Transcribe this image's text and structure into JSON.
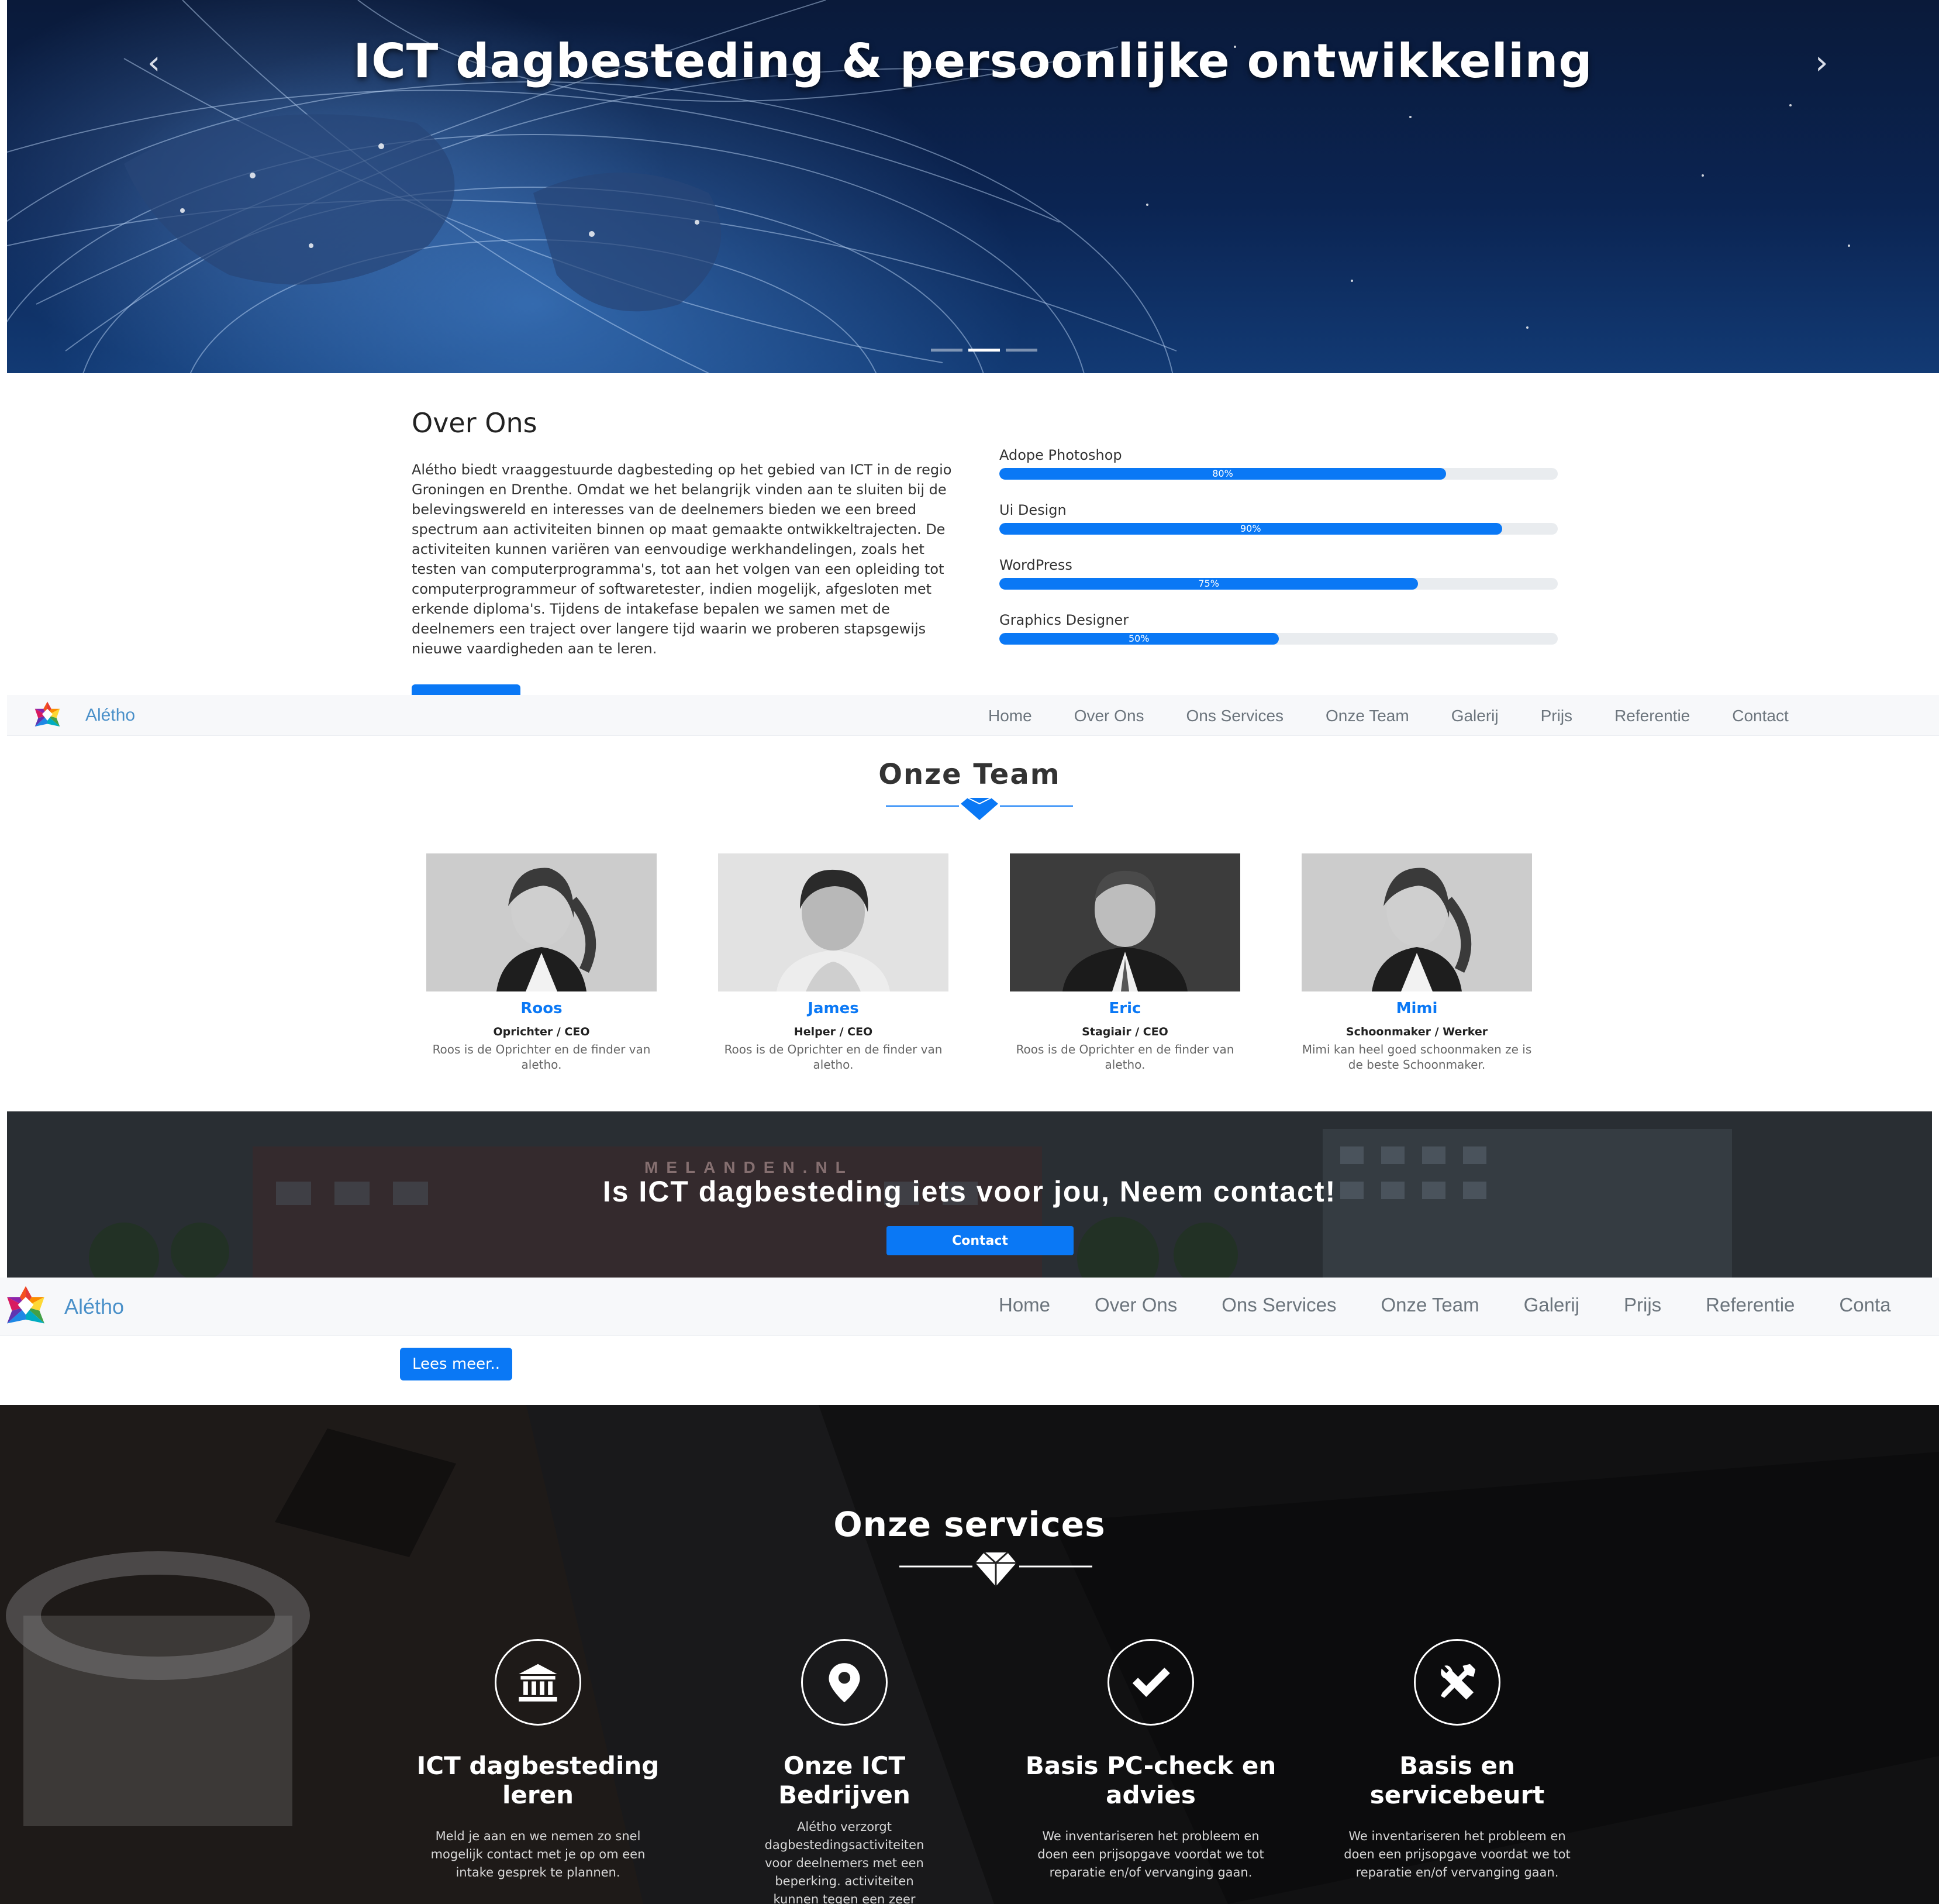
{
  "hero": {
    "title": "ICT dagbesteding & persoonlijke ontwikkeling",
    "prev_icon": "chevron-left-icon",
    "next_icon": "chevron-right-icon",
    "slides": 3,
    "active_slide": 2
  },
  "about": {
    "title": "Over Ons",
    "text": "Alétho biedt vraaggestuurde dagbesteding op het gebied van ICT in de regio Groningen en Drenthe. Omdat we het belangrijk vinden aan te sluiten bij de belevingswereld en interesses van de deelnemers bieden we een breed spectrum aan activiteiten binnen op maat gemaakte ontwikkeltrajecten. De activiteiten kunnen variëren van eenvoudige werkhandelingen, zoals het testen van computerprogramma's, tot aan het volgen van een opleiding tot computerprogrammeur of softwaretester, indien mogelijk, afgesloten met erkende diploma's. Tijdens de intakefase bepalen we samen met de deelnemers een traject over langere tijd waarin we proberen stapsgewijs nieuwe vaardigheden aan te leren.",
    "skills": [
      {
        "label": "Adope Photoshop",
        "percent": 80,
        "text": "80%"
      },
      {
        "label": "Ui Design",
        "percent": 90,
        "text": "90%"
      },
      {
        "label": "WordPress",
        "percent": 75,
        "text": "75%"
      },
      {
        "label": "Graphics Designer",
        "percent": 50,
        "text": "50%"
      }
    ],
    "lees_meer": "Lees meer.."
  },
  "nav": {
    "brand": "Alétho",
    "links": [
      "Home",
      "Over Ons",
      "Ons Services",
      "Onze Team",
      "Galerij",
      "Prijs",
      "Referentie",
      "Contact"
    ],
    "links_cut": [
      "Home",
      "Over Ons",
      "Ons Services",
      "Onze Team",
      "Galerij",
      "Prijs",
      "Referentie",
      "Conta"
    ]
  },
  "team": {
    "title": "Onze Team",
    "members": [
      {
        "name": "Roos",
        "role": "Oprichter / CEO",
        "desc": "Roos is de Oprichter en de finder van aletho."
      },
      {
        "name": "James",
        "role": "Helper / CEO",
        "desc": "Roos is de Oprichter en de finder van aletho."
      },
      {
        "name": "Eric",
        "role": "Stagiair / CEO",
        "desc": "Roos is de Oprichter en de finder van aletho."
      },
      {
        "name": "Mimi",
        "role": "Schoonmaker / Werker",
        "desc": "Mimi kan heel goed schoonmaken ze is de beste Schoonmaker."
      }
    ]
  },
  "cta": {
    "title": "Is ICT dagbesteding iets voor jou, Neem contact!",
    "button": "Contact",
    "building_sign": "MELANDEN.NL"
  },
  "services": {
    "title": "Onze services",
    "items": [
      {
        "icon": "bank-icon",
        "title": "ICT dagbesteding leren",
        "desc": "Meld je aan en we nemen zo snel mogelijk contact met je op om een intake gesprek te plannen."
      },
      {
        "icon": "map-pin-icon",
        "title": "Onze ICT Bedrijven",
        "desc": "Alétho verzorgt dagbestedingsactiviteiten voor deelnemers met een beperking. activiteiten kunnen tegen een zeer"
      },
      {
        "icon": "check-icon",
        "title": "Basis PC-check en advies",
        "desc": "We inventariseren het probleem en doen een prijsopgave voordat we tot reparatie en/of vervanging gaan."
      },
      {
        "icon": "tools-icon",
        "title": "Basis en servicebeurt",
        "desc": "We inventariseren het probleem en doen een prijsopgave voordat we tot reparatie en/of vervanging gaan."
      }
    ]
  },
  "colors": {
    "accent": "#0a78f5",
    "brand": "#4a90c9",
    "nav_bg": "#f7f8fa",
    "nav_link": "#6c757d"
  }
}
